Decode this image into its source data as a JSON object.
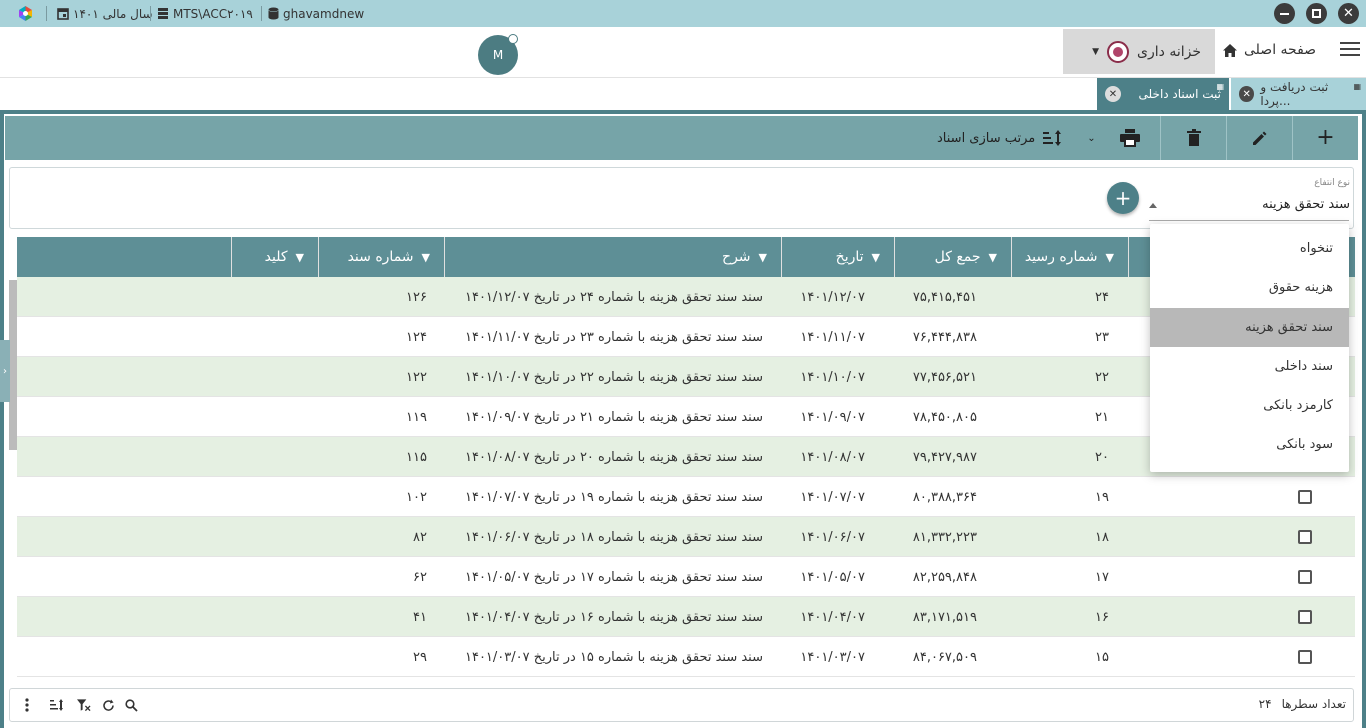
{
  "titlebar": {
    "username": "ghavamdnew",
    "server": "MTS\\ACC۲۰۱۹",
    "fiscal_year": "سال مالی ۱۴۰۱"
  },
  "header": {
    "avatar_letter": "M",
    "ledger_label": "خزانه داری",
    "home_label": "صفحه اصلی"
  },
  "tabs": [
    {
      "label": "ثبت دریافت و پردا..."
    },
    {
      "label": "ثبت اسناد داخلی"
    }
  ],
  "toolbar": {
    "sort_label": "مرتب سازی اسناد"
  },
  "filter": {
    "label": "نوع انتفاع",
    "value": "سند تحقق هزینه"
  },
  "dropdown": {
    "options": [
      "تنخواه",
      "هزینه حقوق",
      "سند تحقق هزینه",
      "سند داخلی",
      "کارمزد بانکی",
      "سود بانکی"
    ],
    "selected": "سند تحقق هزینه"
  },
  "table": {
    "columns": [
      "شماره رسید",
      "جمع کل",
      "تاریخ",
      "شرح",
      "شماره سند",
      "کلید"
    ],
    "rows": [
      {
        "receipt": "۲۴",
        "total": "۷۵,۴۱۵,۴۵۱",
        "date": "۱۴۰۱/۱۲/۰۷",
        "desc": "سند سند تحقق هزینه با شماره  ۲۴ در تاریخ ۱۴۰۱/۱۲/۰۷",
        "docno": "۱۲۶"
      },
      {
        "receipt": "۲۳",
        "total": "۷۶,۴۴۴,۸۳۸",
        "date": "۱۴۰۱/۱۱/۰۷",
        "desc": "سند سند تحقق هزینه با شماره  ۲۳ در تاریخ ۱۴۰۱/۱۱/۰۷",
        "docno": "۱۲۴"
      },
      {
        "receipt": "۲۲",
        "total": "۷۷,۴۵۶,۵۲۱",
        "date": "۱۴۰۱/۱۰/۰۷",
        "desc": "سند سند تحقق هزینه با شماره  ۲۲ در تاریخ ۱۴۰۱/۱۰/۰۷",
        "docno": "۱۲۲"
      },
      {
        "receipt": "۲۱",
        "total": "۷۸,۴۵۰,۸۰۵",
        "date": "۱۴۰۱/۰۹/۰۷",
        "desc": "سند سند تحقق هزینه با شماره  ۲۱ در تاریخ ۱۴۰۱/۰۹/۰۷",
        "docno": "۱۱۹"
      },
      {
        "receipt": "۲۰",
        "total": "۷۹,۴۲۷,۹۸۷",
        "date": "۱۴۰۱/۰۸/۰۷",
        "desc": "سند سند تحقق هزینه با شماره  ۲۰ در تاریخ ۱۴۰۱/۰۸/۰۷",
        "docno": "۱۱۵"
      },
      {
        "receipt": "۱۹",
        "total": "۸۰,۳۸۸,۳۶۴",
        "date": "۱۴۰۱/۰۷/۰۷",
        "desc": "سند سند تحقق هزینه با شماره  ۱۹ در تاریخ ۱۴۰۱/۰۷/۰۷",
        "docno": "۱۰۲"
      },
      {
        "receipt": "۱۸",
        "total": "۸۱,۳۳۲,۲۲۳",
        "date": "۱۴۰۱/۰۶/۰۷",
        "desc": "سند سند تحقق هزینه با شماره  ۱۸ در تاریخ ۱۴۰۱/۰۶/۰۷",
        "docno": "۸۲"
      },
      {
        "receipt": "۱۷",
        "total": "۸۲,۲۵۹,۸۴۸",
        "date": "۱۴۰۱/۰۵/۰۷",
        "desc": "سند سند تحقق هزینه با شماره  ۱۷ در تاریخ ۱۴۰۱/۰۵/۰۷",
        "docno": "۶۲"
      },
      {
        "receipt": "۱۶",
        "total": "۸۳,۱۷۱,۵۱۹",
        "date": "۱۴۰۱/۰۴/۰۷",
        "desc": "سند سند تحقق هزینه با شماره  ۱۶ در تاریخ ۱۴۰۱/۰۴/۰۷",
        "docno": "۴۱"
      },
      {
        "receipt": "۱۵",
        "total": "۸۴,۰۶۷,۵۰۹",
        "date": "۱۴۰۱/۰۳/۰۷",
        "desc": "سند سند تحقق هزینه با شماره  ۱۵ در تاریخ ۱۴۰۱/۰۳/۰۷",
        "docno": "۲۹"
      }
    ]
  },
  "footer": {
    "row_count_label": "تعداد سطرها",
    "row_count": "۲۴"
  },
  "colors": {
    "accent": "#4d8088",
    "toolbar": "#76a4a8",
    "table_header": "#5e8f96",
    "alt_row": "#e5f0e2"
  }
}
